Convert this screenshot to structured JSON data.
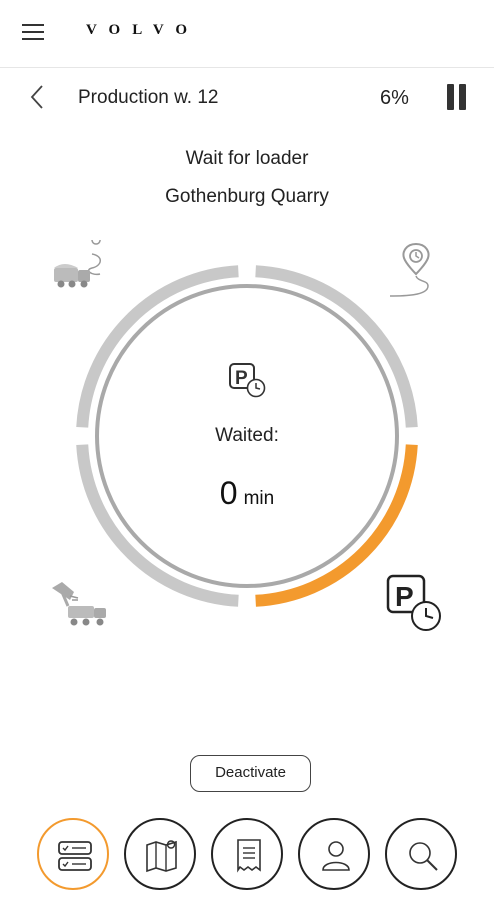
{
  "header": {
    "logo": "VOLVO",
    "menu_icon": "hamburger-menu-icon"
  },
  "subheader": {
    "back_icon": "chevron-left-icon",
    "title": "Production w. 12",
    "progress_percent": "6%",
    "pause_icon": "pause-icon"
  },
  "status": {
    "activity": "Wait for loader",
    "location": "Gothenburg Quarry"
  },
  "dial": {
    "waited_label": "Waited:",
    "waited_value": "0",
    "waited_unit": "min",
    "active_segment": "wait-at-loader",
    "progress_fraction": 0.06,
    "colors": {
      "active": "#f39a2e",
      "inactive": "#c8c8c8",
      "inner": "#a9a9a9"
    },
    "icons": {
      "top_left": "truck-route-icon",
      "top_right": "location-pin-route-icon",
      "bottom_left": "loader-truck-icon",
      "bottom_right": "parking-clock-icon",
      "center": "parking-clock-icon"
    }
  },
  "actions": {
    "deactivate_label": "Deactivate"
  },
  "bottom_nav": [
    {
      "icon": "task-list-icon",
      "active": true
    },
    {
      "icon": "map-icon",
      "active": false
    },
    {
      "icon": "document-icon",
      "active": false
    },
    {
      "icon": "person-icon",
      "active": false
    },
    {
      "icon": "search-icon",
      "active": false
    }
  ]
}
